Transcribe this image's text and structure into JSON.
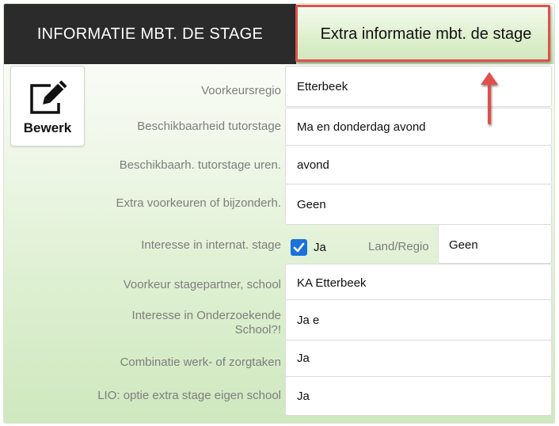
{
  "header": {
    "title": "INFORMATIE MBT. DE STAGE",
    "extra_tab_label": "Extra informatie mbt. de stage"
  },
  "edit_button": {
    "label": "Bewerk",
    "icon": "pencil-edit-icon"
  },
  "annotation": {
    "color": "#e0504c",
    "icon": "up-arrow-icon"
  },
  "fields": [
    {
      "label": "Voorkeursregio",
      "value": "Etterbeek"
    },
    {
      "label": "Beschikbaarheid tutorstage",
      "value": "Ma en donderdag avond"
    },
    {
      "label": "Beschikbaarh. tutorstage uren.",
      "value": "avond"
    },
    {
      "label": "Extra voorkeuren of bijzonderh.",
      "value": "Geen"
    },
    {
      "label": "Interesse in internat. stage",
      "checkbox_label": "Ja",
      "checked": true,
      "sub_label": "Land/Regio",
      "sub_value": "Geen"
    },
    {
      "label": "Voorkeur stagepartner, school",
      "value": "KA Etterbeek"
    },
    {
      "label_line1": "Interesse in Onderzoekende",
      "label_line2": "School?!",
      "value": "Ja e"
    },
    {
      "label": "Combinatie werk- of zorgtaken",
      "value": "Ja"
    },
    {
      "label": "LIO: optie extra stage eigen school",
      "value": "Ja"
    }
  ],
  "colors": {
    "header_bg": "#2b2b2b",
    "checkbox": "#1a73d9",
    "label": "#7d7d7d"
  }
}
